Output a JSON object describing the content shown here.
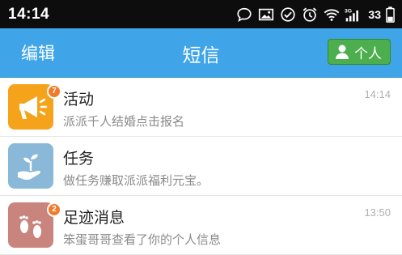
{
  "status_bar": {
    "time": "14:14",
    "network": "3G",
    "battery": "33",
    "icons": [
      "chat-bubble-icon",
      "image-icon",
      "check-circle-icon",
      "alarm-icon",
      "wifi-icon",
      "signal-icon",
      "battery-icon"
    ]
  },
  "nav": {
    "edit_label": "编辑",
    "title": "短信",
    "personal_label": "个人"
  },
  "colors": {
    "nav_bg": "#3fa5e8",
    "personal_button": "#4cae4c",
    "badge": "#f07b2a"
  },
  "messages": [
    {
      "title": "活动",
      "subtitle": "派派千人结婚点击报名",
      "time": "14:14",
      "badge": "7",
      "icon": "megaphone-icon",
      "avatar_color": "#f5a31a"
    },
    {
      "title": "任务",
      "subtitle": "做任务赚取派派福利元宝。",
      "time": "",
      "badge": "",
      "icon": "hand-sprout-icon",
      "avatar_color": "#8ab8d8"
    },
    {
      "title": "足迹消息",
      "subtitle": "笨蛋哥哥查看了你的个人信息",
      "time": "13:50",
      "badge": "2",
      "icon": "footprints-icon",
      "avatar_color": "#c9857d"
    }
  ]
}
